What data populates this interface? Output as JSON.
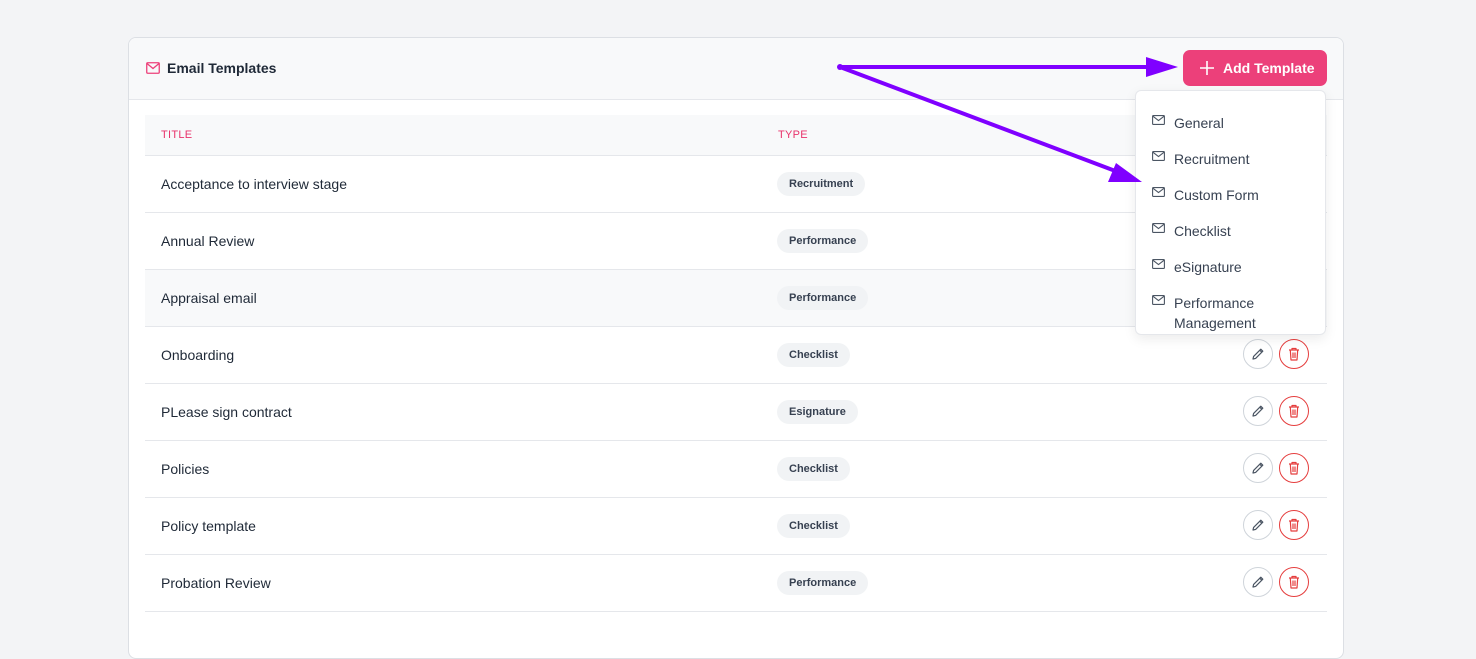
{
  "header": {
    "title": "Email Templates",
    "title_icon": "mail-icon",
    "add_button_label": "Add Template",
    "add_button_icon": "plus-icon"
  },
  "table": {
    "columns": [
      "TITLE",
      "TYPE"
    ],
    "rows": [
      {
        "title": "Acceptance to interview stage",
        "type": "Recruitment"
      },
      {
        "title": "Annual Review",
        "type": "Performance"
      },
      {
        "title": "Appraisal email",
        "type": "Performance"
      },
      {
        "title": "Onboarding",
        "type": "Checklist"
      },
      {
        "title": "PLease sign contract",
        "type": "Esignature"
      },
      {
        "title": "Policies",
        "type": "Checklist"
      },
      {
        "title": "Policy template",
        "type": "Checklist"
      },
      {
        "title": "Probation Review",
        "type": "Performance"
      }
    ]
  },
  "dropdown": {
    "items": [
      "General",
      "Recruitment",
      "Custom Form",
      "Checklist",
      "eSignature",
      "Performance Management"
    ]
  },
  "colors": {
    "accent": "#ec407a",
    "header_text": "#e8336b",
    "delete": "#e53e3e",
    "annotation_arrow": "#7f00ff"
  }
}
